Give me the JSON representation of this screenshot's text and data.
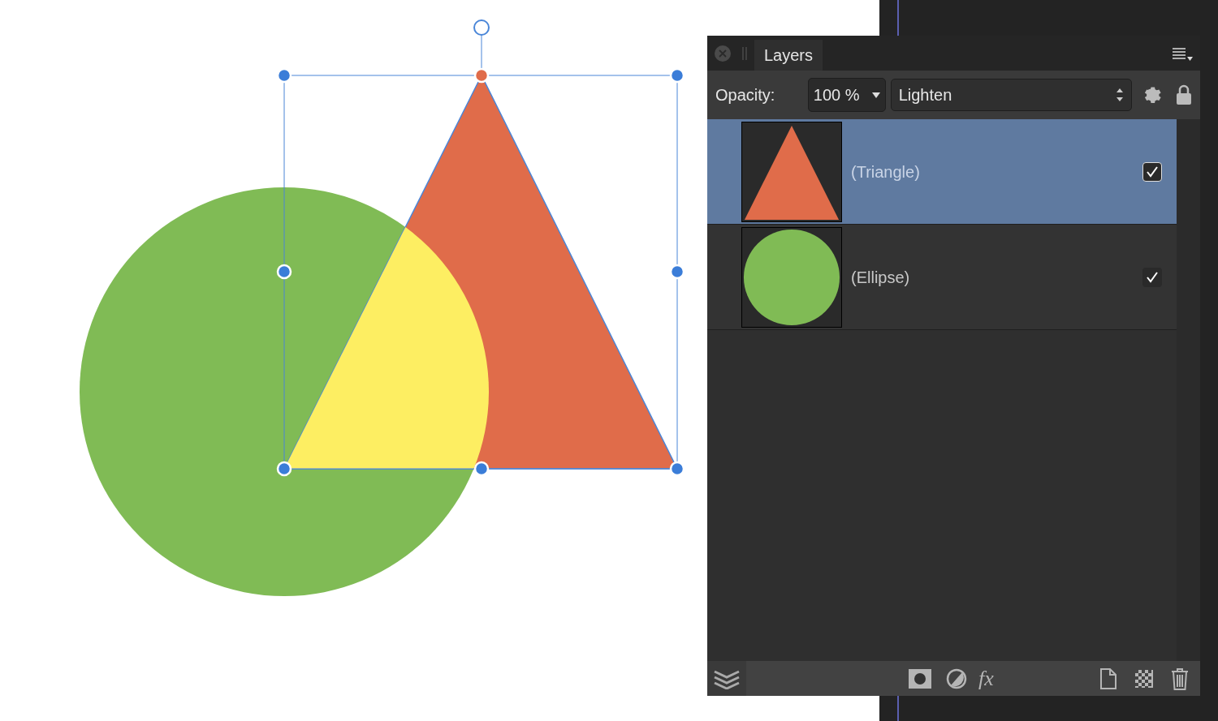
{
  "panel": {
    "tab": "Layers",
    "opacity_label": "Opacity:",
    "opacity_value": "100 %",
    "blend_mode": "Lighten"
  },
  "layers": [
    {
      "name": "(Triangle)",
      "kind": "triangle",
      "selected": true,
      "visible": true
    },
    {
      "name": "(Ellipse)",
      "kind": "ellipse",
      "selected": false,
      "visible": true
    }
  ],
  "footer": {
    "fx_label": "fx"
  }
}
